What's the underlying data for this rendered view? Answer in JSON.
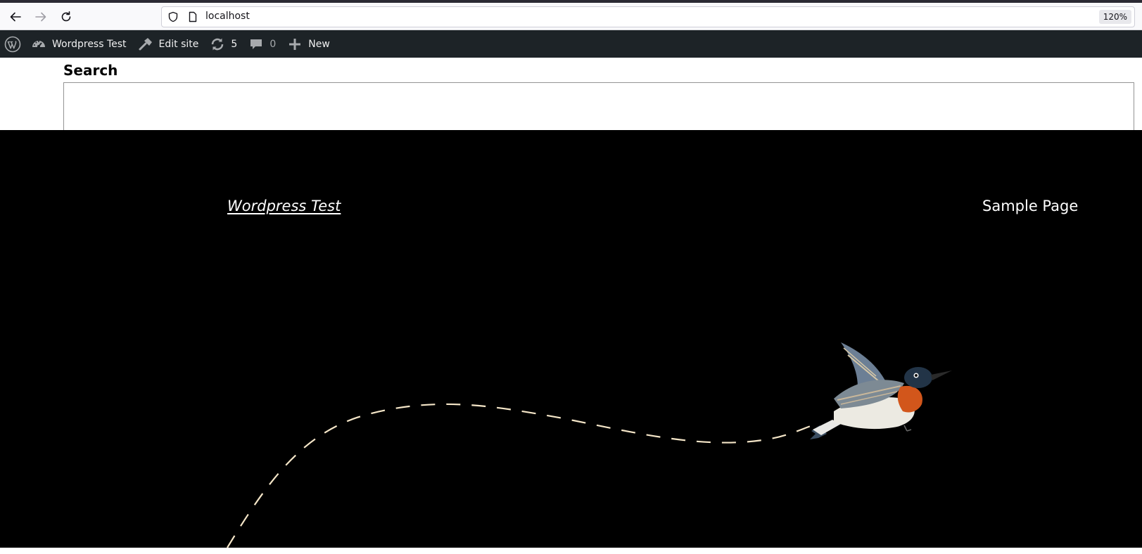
{
  "browser": {
    "url": "localhost",
    "zoom": "120%"
  },
  "admin_bar": {
    "site_name": "Wordpress Test",
    "edit_site": "Edit site",
    "updates_count": "5",
    "comments_count": "0",
    "new_label": "New"
  },
  "search": {
    "label": "Search",
    "value": ""
  },
  "site": {
    "title": "Wordpress Test",
    "nav_items": [
      "Sample Page"
    ]
  },
  "colors": {
    "admin_bar_bg": "#1d2327",
    "hero_bg": "#000000",
    "dash_color": "#f5e6c8"
  },
  "icons": {
    "back": "arrow-left-icon",
    "forward": "arrow-right-icon",
    "reload": "reload-icon",
    "shield": "shield-icon",
    "page": "page-icon",
    "wordpress": "wordpress-logo-icon",
    "dashboard": "dashboard-icon",
    "edit": "hammer-icon",
    "updates": "updates-icon",
    "comments": "comment-icon",
    "new": "plus-icon",
    "bird": "bird-illustration"
  }
}
